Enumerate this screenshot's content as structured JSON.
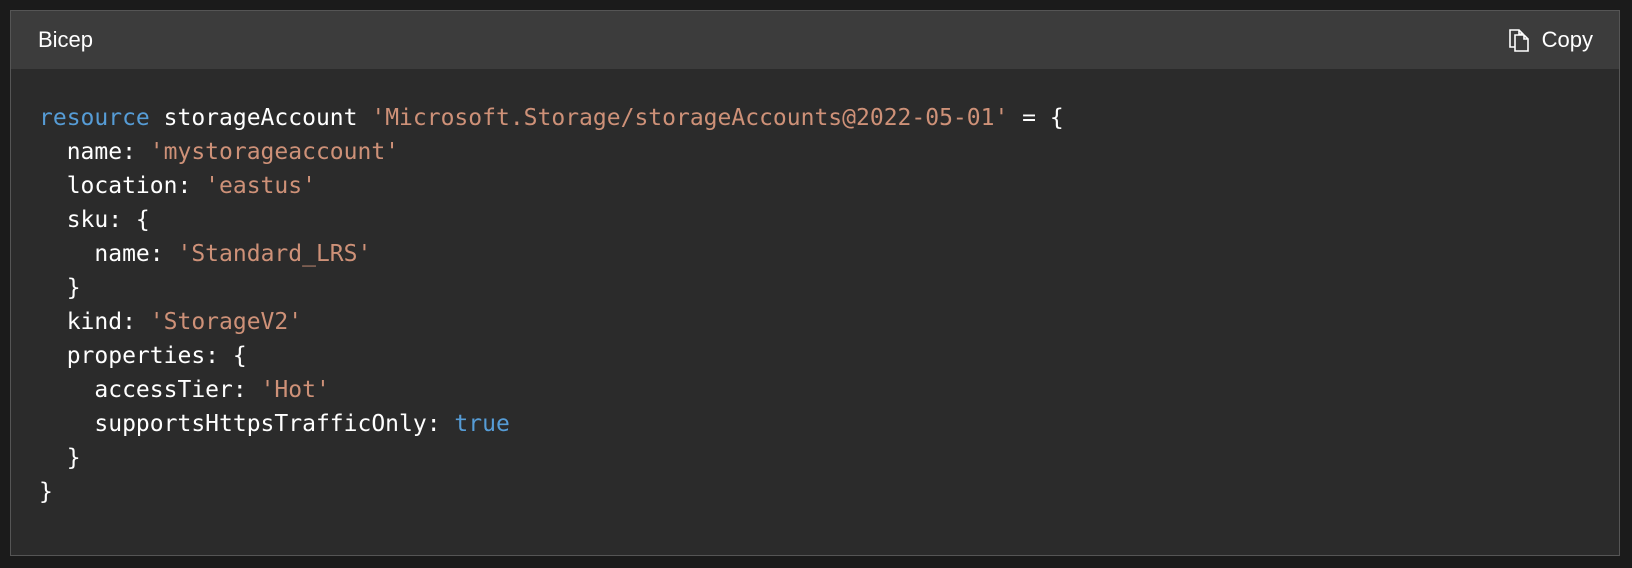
{
  "header": {
    "language_label": "Bicep",
    "copy_label": "Copy",
    "copy_icon": "copy-icon"
  },
  "colors": {
    "background": "#2b2b2b",
    "header_background": "#3c3c3c",
    "keyword": "#569cd6",
    "string": "#ce9178",
    "text": "#ffffff"
  },
  "code": {
    "lines": [
      [
        {
          "t": "resource",
          "k": "keyword"
        },
        {
          "t": " storageAccount ",
          "k": "plain"
        },
        {
          "t": "'Microsoft.Storage/storageAccounts@2022-05-01'",
          "k": "string"
        },
        {
          "t": " = {",
          "k": "plain"
        }
      ],
      [
        {
          "t": "  name: ",
          "k": "plain"
        },
        {
          "t": "'mystorageaccount'",
          "k": "string"
        }
      ],
      [
        {
          "t": "  location: ",
          "k": "plain"
        },
        {
          "t": "'eastus'",
          "k": "string"
        }
      ],
      [
        {
          "t": "  sku: {",
          "k": "plain"
        }
      ],
      [
        {
          "t": "    name: ",
          "k": "plain"
        },
        {
          "t": "'Standard_LRS'",
          "k": "string"
        }
      ],
      [
        {
          "t": "  }",
          "k": "plain"
        }
      ],
      [
        {
          "t": "  kind: ",
          "k": "plain"
        },
        {
          "t": "'StorageV2'",
          "k": "string"
        }
      ],
      [
        {
          "t": "  properties: {",
          "k": "plain"
        }
      ],
      [
        {
          "t": "    accessTier: ",
          "k": "plain"
        },
        {
          "t": "'Hot'",
          "k": "string"
        }
      ],
      [
        {
          "t": "    supportsHttpsTrafficOnly: ",
          "k": "plain"
        },
        {
          "t": "true",
          "k": "keyword"
        }
      ],
      [
        {
          "t": "  }",
          "k": "plain"
        }
      ],
      [
        {
          "t": "}",
          "k": "plain"
        }
      ]
    ]
  }
}
